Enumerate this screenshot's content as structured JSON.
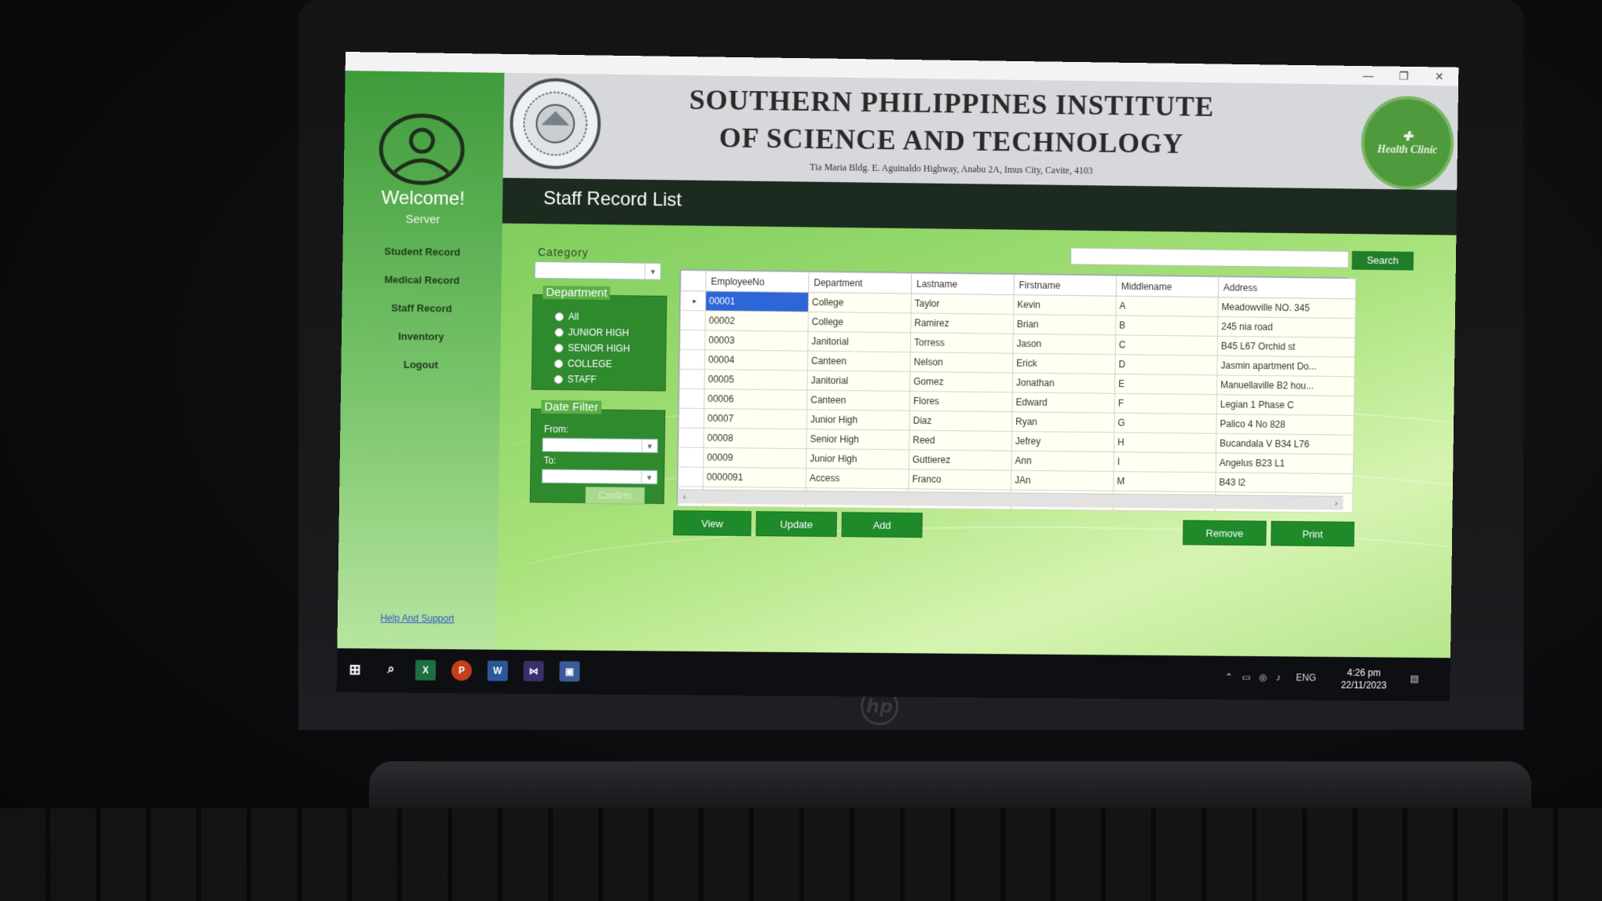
{
  "window": {
    "minimize_glyph": "—",
    "restore_glyph": "❐",
    "close_glyph": "✕"
  },
  "sidebar": {
    "welcome": "Welcome!",
    "role": "Server",
    "items": [
      {
        "label": "Student Record"
      },
      {
        "label": "Medical Record"
      },
      {
        "label": "Staff Record"
      },
      {
        "label": "Inventory"
      },
      {
        "label": "Logout"
      }
    ],
    "help_link": "Help And Support"
  },
  "header": {
    "school_line1": "SOUTHERN PHILIPPINES INSTITUTE",
    "school_line2": "OF SCIENCE AND TECHNOLOGY",
    "address": "Tia Maria Bldg. E. Aguinaldo Highway, Anabu 2A, Imus City, Cavite, 4103",
    "clinic_logo_text": "Health Clinic"
  },
  "page_title": "Staff Record List",
  "filters": {
    "category_label": "Category",
    "category_value": "",
    "department_title": "Department",
    "department_options": [
      "All",
      "JUNIOR HIGH",
      "SENIOR HIGH",
      "COLLEGE",
      "STAFF"
    ],
    "date_filter_title": "Date Filter",
    "from_label": "From:",
    "to_label": "To:",
    "confirm_label": "Confirm"
  },
  "search": {
    "value": "",
    "button_label": "Search"
  },
  "table": {
    "columns": [
      "EmployeeNo",
      "Department",
      "Lastname",
      "Firstname",
      "Middlename",
      "Address"
    ],
    "rows": [
      [
        "00001",
        "College",
        "Taylor",
        "Kevin",
        "A",
        "Meadowville NO. 345"
      ],
      [
        "00002",
        "College",
        "Ramirez",
        "Brian",
        "B",
        "245 nia road"
      ],
      [
        "00003",
        "Janitorial",
        "Torress",
        "Jason",
        "C",
        "B45 L67 Orchid st"
      ],
      [
        "00004",
        "Canteen",
        "Nelson",
        "Erick",
        "D",
        "Jasmin apartment Do..."
      ],
      [
        "00005",
        "Janitorial",
        "Gomez",
        "Jonathan",
        "E",
        "Manuellaville B2 hou..."
      ],
      [
        "00006",
        "Canteen",
        "Flores",
        "Edward",
        "F",
        "Legian 1 Phase C"
      ],
      [
        "00007",
        "Junior High",
        "Diaz",
        "Ryan",
        "G",
        "Palico 4 No 828"
      ],
      [
        "00008",
        "Senior High",
        "Reed",
        "Jefrey",
        "H",
        "Bucandala V B34 L76"
      ],
      [
        "00009",
        "Junior High",
        "Guttierez",
        "Ann",
        "I",
        "Angelus B23 L1"
      ],
      [
        "0000091",
        "Access",
        "Franco",
        "JAn",
        "M",
        "B43 l2"
      ]
    ],
    "current_row_marker": "▸",
    "new_row_marker": "*"
  },
  "actions": {
    "view": "View",
    "update": "Update",
    "add": "Add",
    "remove": "Remove",
    "print": "Print"
  },
  "taskbar": {
    "apps": [
      "windows-start",
      "search",
      "excel",
      "powerpoint",
      "word",
      "visual-studio",
      "app-window"
    ],
    "language": "ENG",
    "time": "4:26 pm",
    "date": "22/11/2023"
  },
  "colors": {
    "sidebar_green": "#3f9b3c",
    "button_green": "#1f8a2a",
    "selection_blue": "#2e66d8",
    "header_gray": "#d7d8dc"
  }
}
